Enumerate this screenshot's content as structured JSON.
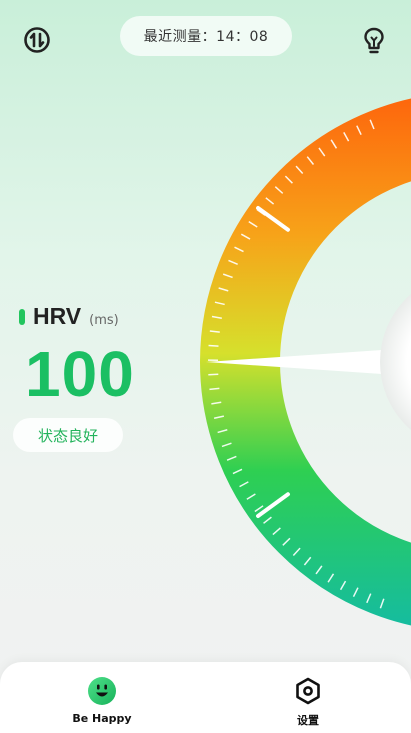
{
  "header": {
    "last_measure_label": "最近测量：14：08",
    "left_icon": "swap-arrows-icon",
    "right_icon": "lightbulb-icon"
  },
  "metric": {
    "name": "HRV",
    "unit": "(ms)",
    "value": "100",
    "status": "状态良好",
    "accent_color": "#1bbf63"
  },
  "gauge": {
    "value": 100,
    "gradient_colors": [
      "#ff5a0a",
      "#f7a319",
      "#d6e02c",
      "#2ecf52",
      "#10b8b0"
    ]
  },
  "nav": {
    "items": [
      {
        "label": "Be Happy",
        "icon": "smile-face-icon",
        "active": true
      },
      {
        "label": "设置",
        "icon": "hexagon-settings-icon",
        "active": false
      }
    ]
  }
}
